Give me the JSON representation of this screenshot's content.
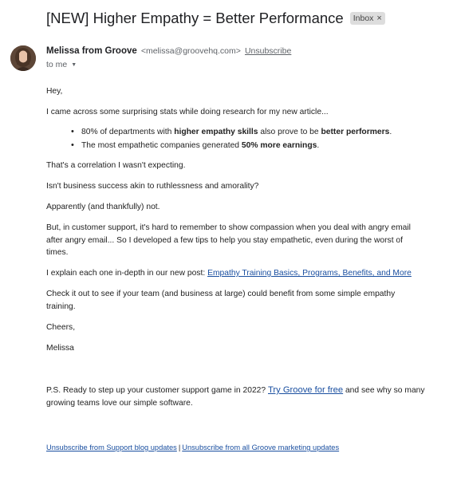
{
  "email": {
    "subject": "[NEW] Higher Empathy = Better Performance",
    "label_chip": "Inbox",
    "label_chip_close": "×",
    "sender_name": "Melissa from Groove",
    "sender_email": "<melissa@groovehq.com>",
    "unsubscribe_label": "Unsubscribe",
    "to_label": "to me",
    "to_caret": "▼"
  },
  "body": {
    "greeting": "Hey,",
    "intro": "I came across some surprising stats while doing research for my new article...",
    "bullet1": {
      "part1": "80% of departments with ",
      "bold1": "higher empathy skills",
      "part2": " also prove to be ",
      "bold2": "better performers",
      "part3": "."
    },
    "bullet2": {
      "part1": "The most empathetic companies generated ",
      "bold1": "50% more earnings",
      "part2": "."
    },
    "p_correlation": "That's a correlation I wasn't expecting.",
    "p_question": "Isn't business success akin to ruthlessness and amorality?",
    "p_apparently": "Apparently (and thankfully) not.",
    "p_but": "But, in customer support, it's hard to remember to show compassion when you deal with angry email after angry email... So I developed a few tips to help you stay empathetic, even during the worst of times.",
    "p_explain_prefix": "I explain each one in-depth in our new post: ",
    "p_explain_link": "Empathy Training Basics, Programs, Benefits, and More",
    "p_check": "Check it out to see if your team (and business at large) could benefit from some simple empathy training.",
    "signoff": "Cheers,",
    "signature": "Melissa",
    "ps_prefix": "P.S. Ready to step up your customer support game in 2022? ",
    "ps_link": "Try Groove for free",
    "ps_suffix": " and see why so many growing teams love our simple software."
  },
  "footer": {
    "link1": "Unsubscribe from Support blog updates",
    "separator": "|",
    "link2": "Unsubscribe from all Groove marketing updates"
  },
  "colors": {
    "link": "#1a4fa0",
    "chip_background": "#dddddd",
    "muted_text": "#5f6368"
  },
  "icons": {
    "avatar": "sender-avatar",
    "chip_close": "close-icon",
    "to_dropdown": "chevron-down-icon"
  }
}
